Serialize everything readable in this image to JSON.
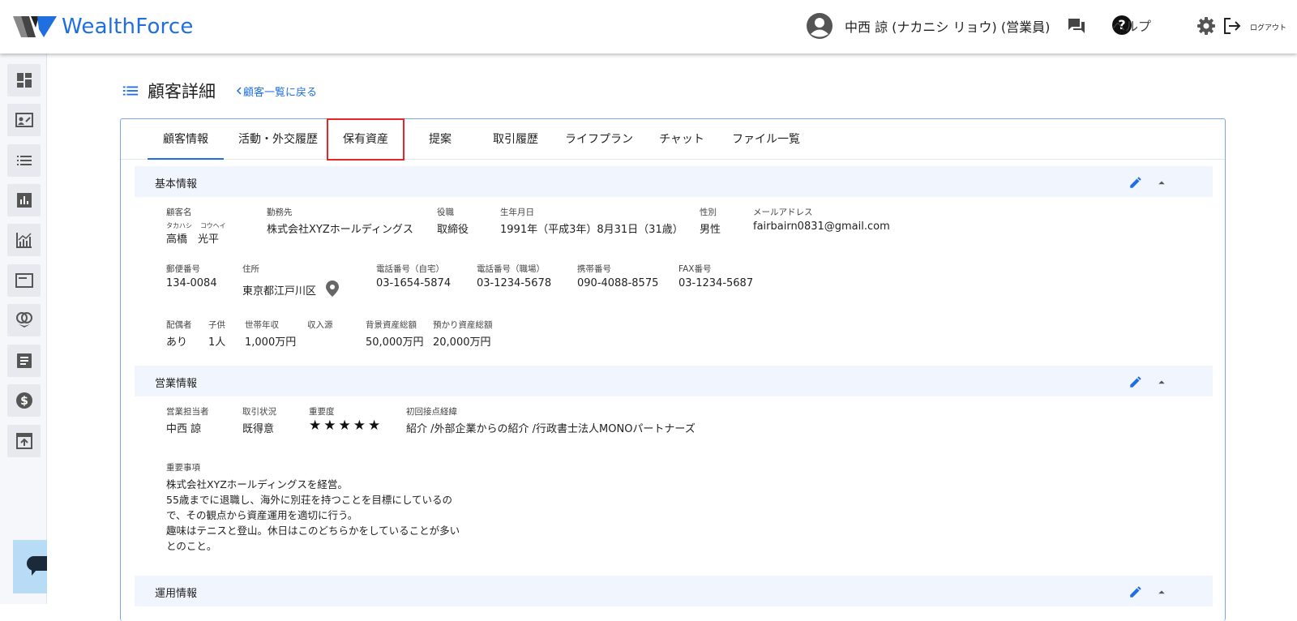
{
  "app": {
    "logo": "WealthForce"
  },
  "header": {
    "user_name": "中西 諒 (ナカニシ リョウ) (営業員)",
    "help_label": "ヘルプ",
    "help_icon_glyph": "?",
    "logout_label": "ログアウト"
  },
  "page": {
    "title": "顧客詳細",
    "back_link": "顧客一覧に戻る"
  },
  "tabs": [
    {
      "label": "顧客情報",
      "active": true
    },
    {
      "label": "活動・外交履歴"
    },
    {
      "label": "保有資産",
      "highlighted": true
    },
    {
      "label": "提案"
    },
    {
      "label": "取引履歴"
    },
    {
      "label": "ライフプラン"
    },
    {
      "label": "チャット"
    },
    {
      "label": "ファイル一覧"
    }
  ],
  "basic": {
    "title": "基本情報",
    "name_label": "顧客名",
    "name_ruby_last": "タカハシ",
    "name_ruby_first": "コウヘイ",
    "name": "高橋　光平",
    "company_label": "勤務先",
    "company": "株式会社XYZホールディングス",
    "position_label": "役職",
    "position": "取締役",
    "birth_label": "生年月日",
    "birth": "1991年（平成3年）8月31日（31歳）",
    "gender_label": "性別",
    "gender": "男性",
    "email_label": "メールアドレス",
    "email": "fairbairn0831@gmail.com",
    "zip_label": "郵便番号",
    "zip": "134-0084",
    "address_label": "住所",
    "address": "東京都江戸川区",
    "tel_home_label": "電話番号（自宅）",
    "tel_home": "03-1654-5874",
    "tel_work_label": "電話番号（職場）",
    "tel_work": "03-1234-5678",
    "mobile_label": "携帯番号",
    "mobile": "090-4088-8575",
    "fax_label": "FAX番号",
    "fax": "03-1234-5687",
    "spouse_label": "配偶者",
    "spouse": "あり",
    "children_label": "子供",
    "children": "1人",
    "income_label": "世帯年収",
    "income": "1,000万円",
    "income_src_label": "収入源",
    "bg_assets_label": "背景資産総額",
    "bg_assets": "50,000万円",
    "deposit_label": "預かり資産総額",
    "deposit": "20,000万円"
  },
  "sales": {
    "title": "営業情報",
    "rep_label": "営業担当者",
    "rep": "中西 諒",
    "status_label": "取引状況",
    "status": "既得意",
    "importance_label": "重要度",
    "importance_stars": "★★★★★",
    "importance_value": 5,
    "contact_label": "初回接点経緯",
    "contact": "紹介 /外部企業からの紹介 /行政書士法人MONOパートナーズ",
    "notes_label": "重要事項",
    "notes": [
      "株式会社XYZホールディングスを経営。",
      "55歳までに退職し、海外に別荘を持つことを目標にしているの",
      "で、その観点から資産運用を適切に行う。",
      "趣味はテニスと登山。休日はこのどちらかをしていることが多い",
      "とのこと。"
    ]
  },
  "ops": {
    "title": "運用情報"
  },
  "colors": {
    "accent": "#1f6fe0",
    "tab_highlight": "#e52727",
    "section_bg": "#f1f5fd"
  }
}
